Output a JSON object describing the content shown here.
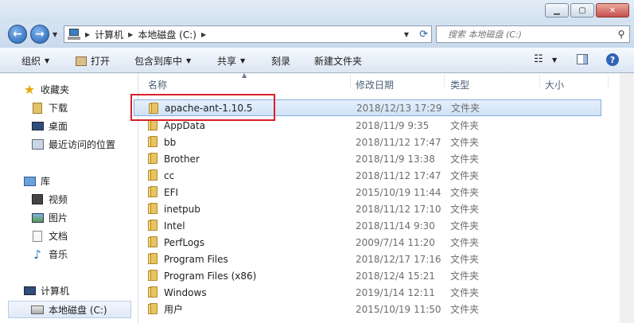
{
  "address": {
    "crumbs": [
      "计算机",
      "本地磁盘 (C:)"
    ]
  },
  "search": {
    "placeholder": "搜索 本地磁盘 (C:)"
  },
  "toolbar": {
    "organize": "组织",
    "open": "打开",
    "include_library": "包含到库中",
    "share": "共享",
    "burn": "刻录",
    "new_folder": "新建文件夹"
  },
  "sidebar": {
    "favorites": "收藏夹",
    "downloads": "下载",
    "desktop": "桌面",
    "recent": "最近访问的位置",
    "libraries": "库",
    "videos": "视频",
    "pictures": "图片",
    "documents": "文档",
    "music": "音乐",
    "computer": "计算机",
    "local_disk": "本地磁盘 (C:)"
  },
  "columns": {
    "name": "名称",
    "modified": "修改日期",
    "type": "类型",
    "size": "大小"
  },
  "files": [
    {
      "name": "apache-ant-1.10.5",
      "date": "2018/12/13 17:29",
      "type": "文件夹"
    },
    {
      "name": "AppData",
      "date": "2018/11/9 9:35",
      "type": "文件夹"
    },
    {
      "name": "bb",
      "date": "2018/11/12 17:47",
      "type": "文件夹"
    },
    {
      "name": "Brother",
      "date": "2018/11/9 13:38",
      "type": "文件夹"
    },
    {
      "name": "cc",
      "date": "2018/11/12 17:47",
      "type": "文件夹"
    },
    {
      "name": "EFI",
      "date": "2015/10/19 11:44",
      "type": "文件夹"
    },
    {
      "name": "inetpub",
      "date": "2018/11/12 17:10",
      "type": "文件夹"
    },
    {
      "name": "Intel",
      "date": "2018/11/14 9:30",
      "type": "文件夹"
    },
    {
      "name": "PerfLogs",
      "date": "2009/7/14 11:20",
      "type": "文件夹"
    },
    {
      "name": "Program Files",
      "date": "2018/12/17 17:16",
      "type": "文件夹"
    },
    {
      "name": "Program Files (x86)",
      "date": "2018/12/4 15:21",
      "type": "文件夹"
    },
    {
      "name": "Windows",
      "date": "2019/1/14 12:11",
      "type": "文件夹"
    },
    {
      "name": "用户",
      "date": "2015/10/19 11:50",
      "type": "文件夹"
    }
  ]
}
